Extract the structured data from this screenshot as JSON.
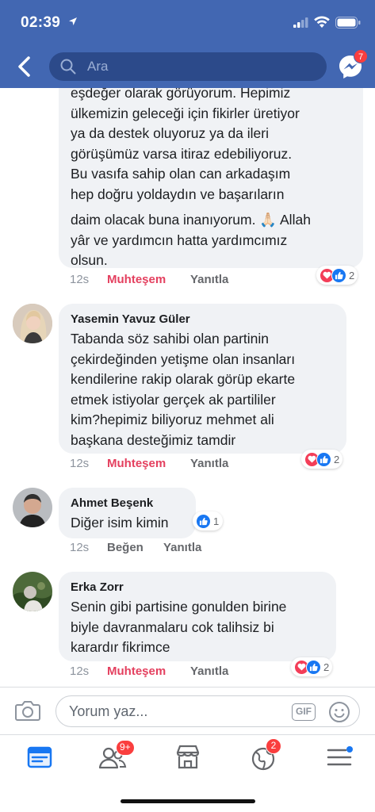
{
  "status_bar": {
    "time": "02:39"
  },
  "header": {
    "search_placeholder": "Ara",
    "messenger_badge": "7"
  },
  "colors": {
    "brand": "#4267b2",
    "love": "#e4405f",
    "like": "#1877f2",
    "badge": "#fa3e3e"
  },
  "comments": [
    {
      "lines": [
        "eşdeğer olarak görüyorum. Hepimiz",
        "ülkemizin geleceği için fikirler üretiyor",
        "ya da destek oluyoruz ya da ileri",
        "görüşümüz varsa itiraz edebiliyoruz.",
        "Bu vasıfa sahip olan can arkadaşım",
        "hep doğru yoldaydın ve başarıların",
        "daim olacak buna inanıyorum. 🙏🏻 Allah",
        "yâr ve yardımcın hatta yardımcımız",
        "olsun."
      ],
      "time": "12s",
      "reaction": "Muhteşem",
      "reply": "Yanıtla",
      "reaction_count": "2"
    },
    {
      "author": "Yasemin Yavuz Güler",
      "lines": [
        "Tabanda söz sahibi olan partinin",
        "çekirdeğinden yetişme olan insanları",
        "kendilerine rakip olarak görüp ekarte",
        "etmek istiyolar gerçek ak partililer",
        "kim?hepimiz biliyoruz mehmet ali",
        "başkana desteğimiz tamdir"
      ],
      "time": "12s",
      "reaction": "Muhteşem",
      "reply": "Yanıtla",
      "reaction_count": "2"
    },
    {
      "author": "Ahmet Beşenk",
      "lines": [
        "Diğer isim kimin"
      ],
      "time": "12s",
      "reaction": "Beğen",
      "reply": "Yanıtla",
      "reaction_count": "1"
    },
    {
      "author": "Erka Zorr",
      "lines": [
        "Senin gibi partisine gonulden birine",
        "biyle davranmalaru cok talihsiz bi",
        "karardır fikrimce"
      ],
      "time": "12s",
      "reaction": "Muhteşem",
      "reply": "Yanıtla",
      "reaction_count": "2"
    }
  ],
  "compose": {
    "placeholder": "Yorum yaz...",
    "gif": "GIF"
  },
  "tabbar": {
    "friends_badge": "9+",
    "notifications_badge": "2"
  }
}
